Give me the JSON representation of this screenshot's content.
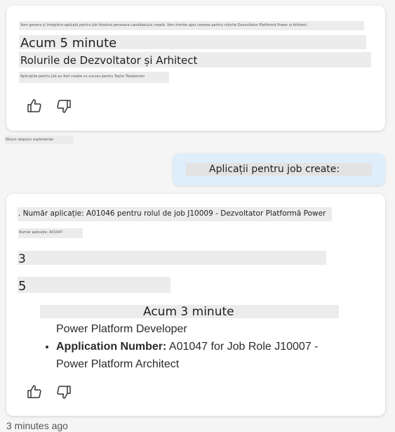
{
  "card1": {
    "top_line": "Vom genera și înregistra aplicații pentru job folosind persoana candidatului creată. Vom trimite apoi cererea pentru rolurile Dezvoltator Platformă Power și Arhitect.",
    "time": "Acum 5 minute",
    "title": "Rolurile de Dezvoltator și Arhitect",
    "sub": "Aplicațiile pentru job au fost create cu succes pentru Taylor Testperson",
    "like_icon": "thumbs-up-icon",
    "dislike_icon": "thumbs-down-icon"
  },
  "between_note": "Niciun răspuns suplimentar",
  "user_message": "Aplicații pentru job create:",
  "card2": {
    "line1": ". Număr aplicație: A01046 pentru rolul de job J10009 - Dezvoltator Platformă Power",
    "line2": "Număr aplicație: A01047",
    "num3": "3",
    "num5": "5",
    "time": "Acum 3 minute",
    "cont_line": "Power Platform Developer",
    "item_label": "Application Number:",
    "item_text": " A01047 for Job Role J10007 -",
    "item_cont": "Power Platform Architect",
    "like_icon": "thumbs-up-icon",
    "dislike_icon": "thumbs-down-icon"
  },
  "footer_time": "3 minutes ago"
}
